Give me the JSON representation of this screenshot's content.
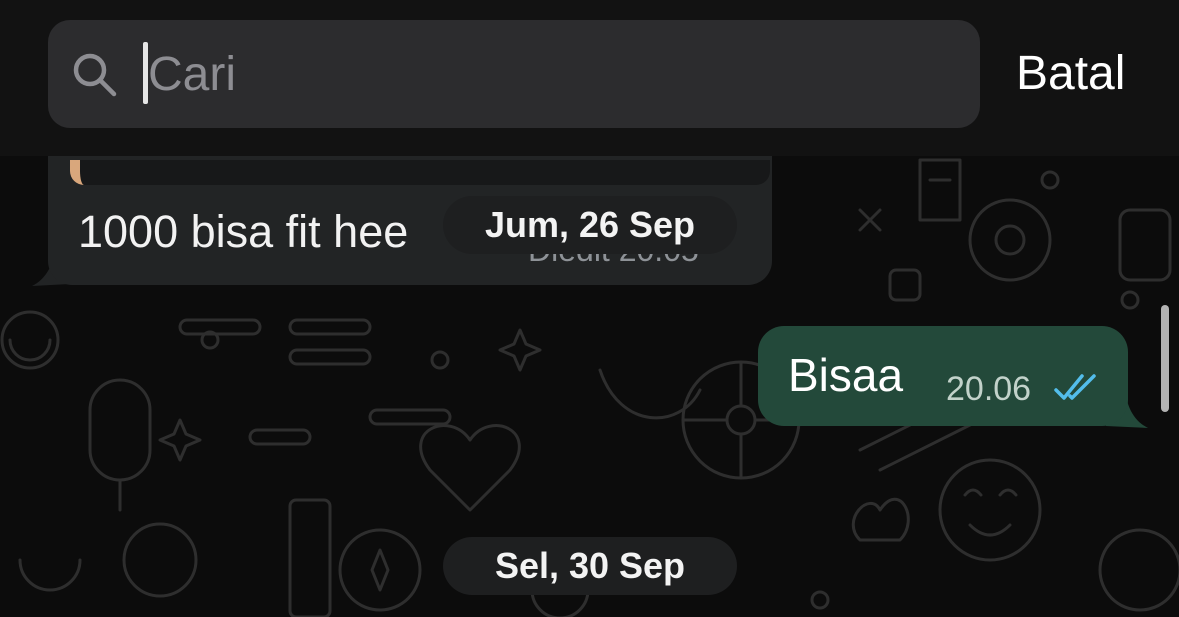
{
  "search": {
    "placeholder": "Cari",
    "value": "",
    "cancel_label": "Batal"
  },
  "messages": [
    {
      "direction": "incoming",
      "text": "1000 bisa fit hee",
      "meta": "Diedit 20.05"
    },
    {
      "direction": "outgoing",
      "text": "Bisaa",
      "time": "20.06",
      "status": "read"
    }
  ],
  "date_separators": [
    "Jum, 26 Sep",
    "Sel, 30 Sep"
  ],
  "icons": {
    "search": "search-icon",
    "read_receipt": "double-check-icon"
  },
  "colors": {
    "background": "#0c0c0c",
    "incoming_bubble": "#222425",
    "outgoing_bubble": "#23493a",
    "read_check": "#53bdeb",
    "quote_accent": "#d9a77c"
  }
}
